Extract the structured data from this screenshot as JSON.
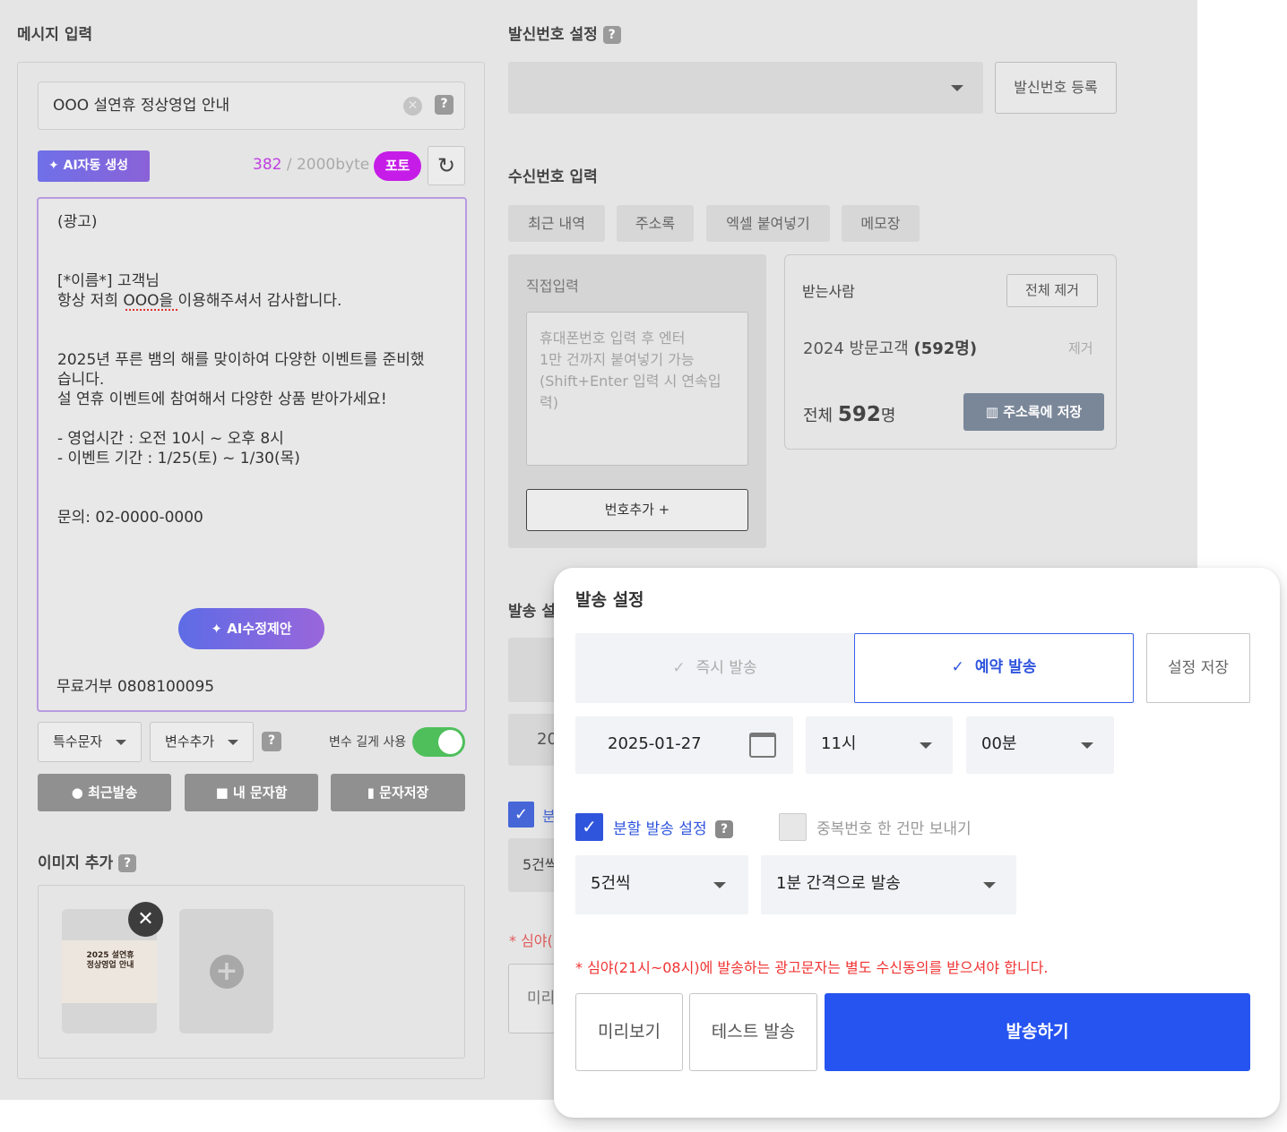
{
  "left": {
    "section_title": "메시지 입력",
    "title_input_value": "OOO 설연휴 정상영업 안내",
    "ai_generate_label": "AI자동 생성",
    "byte_count": "382",
    "byte_limit": " / 2000byte",
    "photo_badge": "포토",
    "message_lines": "(광고)\n\n\n[*이름*] 고객님\n항상 저희 OOO을 이용해주셔서 감사합니다.\n\n\n2025년 푸른 뱀의 해를 맞이하여 다양한 이벤트를 준비했\n습니다.\n설 연휴 이벤트에 참여해서 다양한 상품 받아가세요!\n\n- 영업시간 : 오전 10시 ~ 오후 8시\n- 이벤트 기간 : 1/25(토) ~ 1/30(목)\n\n\n문의: 02-0000-0000",
    "ai_suggest_label": "AI수정제안",
    "reject_text": "무료거부 0808100095",
    "special_char_label": "특수문자",
    "add_var_label": "변수추가",
    "long_var_label": "변수 길게 사용",
    "recent_send_label": "최근발송",
    "my_box_label": "내 문자함",
    "save_msg_label": "문자저장",
    "image_section_title": "이미지 추가",
    "thumb_text": "2025 설연휴\n정상영업 안내"
  },
  "sender": {
    "section_title": "발신번호 설정",
    "register_label": "발신번호 등록"
  },
  "receiver": {
    "section_title": "수신번호 입력",
    "tabs": [
      "최근 내역",
      "주소록",
      "엑셀 붙여넣기",
      "메모장"
    ],
    "direct_label": "직접입력",
    "direct_placeholder": "휴대폰번호 입력 후 엔터\n1만 건까지 붙여넣기 가능\n(Shift+Enter 입력 시 연속입\n력)",
    "add_number_label": "번호추가 +",
    "recipients_label": "받는사람",
    "remove_all_label": "전체 제거",
    "group_name": "2024 방문고객 ",
    "group_count": "(592명)",
    "remove_label": "제거",
    "total_prefix": "전체 ",
    "total_count": "592",
    "total_suffix": "명",
    "save_address_label": "주소록에 저장"
  },
  "background_peek": {
    "send_title": "발송 설",
    "date_prefix": "20",
    "split_prefix": "분",
    "count_prefix": "5건씩",
    "notice_prefix": "* 심야(",
    "preview_prefix": "미리"
  },
  "popup": {
    "title": "발송 설정",
    "instant_label": "즉시 발송",
    "reserved_label": "예약 발송",
    "save_setting_label": "설정 저장",
    "date_value": "2025-01-27",
    "hour_value": "11시",
    "minute_value": "00분",
    "split_label": "분할 발송 설정",
    "dedupe_label": "중복번호 한 건만 보내기",
    "batch_value": "5건씩",
    "interval_value": "1분 간격으로 발송",
    "notice": "* 심야(21시~08시)에 발송하는 광고문자는 별도 수신동의를 받으셔야 합니다.",
    "preview_label": "미리보기",
    "test_label": "테스트 발송",
    "send_label": "발송하기"
  },
  "colors": {
    "primary_blue": "#2654f0",
    "toggle_green": "#4fbf5c",
    "photo_badge": "#c61ce8",
    "notice_red": "#f03333"
  }
}
